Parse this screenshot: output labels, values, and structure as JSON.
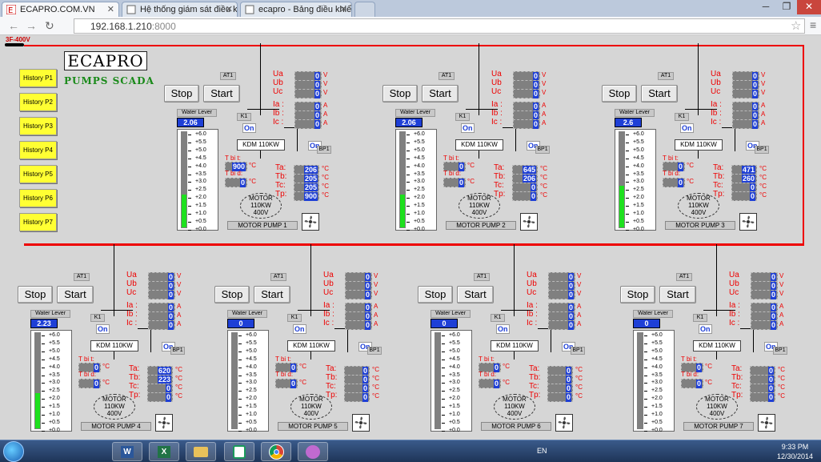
{
  "browser": {
    "tabs": [
      {
        "title": "ECAPRO.COM.VN"
      },
      {
        "title": "Hệ thống giám sát điều kh"
      },
      {
        "title": "ecapro - Bảng điều khiển"
      }
    ],
    "url_host": "192.168.1.210",
    "url_port": ":8000"
  },
  "scada": {
    "panel_tag": "3F-400V",
    "logo": "ECAPRO",
    "subtitle": "PUMPS SCADA",
    "history": [
      "History P1",
      "History P2",
      "History P3",
      "History P4",
      "History P5",
      "History P6",
      "History P7"
    ],
    "labels": {
      "stop": "Stop",
      "start": "Start",
      "water_level": "Water Lever",
      "at1": "AT1",
      "k1": "K1",
      "on": "On",
      "bp1": "BP1",
      "kdm": "KDM 110KW",
      "motor_l1": "MOTOR",
      "motor_l2": "110KW",
      "motor_l3": "400V",
      "ua": "Ua",
      "ub": "Ub",
      "uc": "Uc",
      "ia": "Ia :",
      "ib": "Ib :",
      "ic": "Ic :",
      "ta": "Ta:",
      "tb": "Tb:",
      "tc": "Tc:",
      "tp": "Tp:",
      "tbit": "T bi t:",
      "tbid": "T bi d:",
      "unit_v": "V",
      "unit_a": "A",
      "unit_c": "°C"
    },
    "ticks": [
      "+6.0",
      "+5.5",
      "+5.0",
      "+4.5",
      "+4.0",
      "+3.5",
      "+3.0",
      "+2.5",
      "+2.0",
      "+1.5",
      "+1.0",
      "+0.5",
      "+0.0"
    ],
    "pumps": [
      {
        "name": "MOTOR PUMP 1",
        "level_text": "2.06",
        "level": 2.06,
        "ua": "0",
        "ub": "0",
        "uc": "0",
        "ia": "0",
        "ib": "0",
        "ic": "0",
        "tbit": "900",
        "tbid": "0",
        "ta": "206",
        "tb": "205",
        "tc": "205",
        "tp": "900"
      },
      {
        "name": "MOTOR PUMP 2",
        "level_text": "2.06",
        "level": 2.06,
        "ua": "0",
        "ub": "0",
        "uc": "0",
        "ia": "0",
        "ib": "0",
        "ic": "0",
        "tbit": "0",
        "tbid": "0",
        "ta": "645",
        "tb": "206",
        "tc": "0",
        "tp": "0"
      },
      {
        "name": "MOTOR PUMP 3",
        "level_text": "2.6",
        "level": 2.6,
        "ua": "0",
        "ub": "0",
        "uc": "0",
        "ia": "0",
        "ib": "0",
        "ic": "0",
        "tbit": "0",
        "tbid": "0",
        "ta": "471",
        "tb": "260",
        "tc": "0",
        "tp": "0"
      },
      {
        "name": "MOTOR PUMP 4",
        "level_text": "2.23",
        "level": 2.23,
        "ua": "0",
        "ub": "0",
        "uc": "0",
        "ia": "0",
        "ib": "0",
        "ic": "0",
        "tbit": "0",
        "tbid": "0",
        "ta": "620",
        "tb": "223",
        "tc": "0",
        "tp": "0"
      },
      {
        "name": "MOTOR PUMP 5",
        "level_text": "0",
        "level": 0,
        "ua": "0",
        "ub": "0",
        "uc": "0",
        "ia": "0",
        "ib": "0",
        "ic": "0",
        "tbit": "0",
        "tbid": "0",
        "ta": "0",
        "tb": "0",
        "tc": "0",
        "tp": "0"
      },
      {
        "name": "MOTOR PUMP 6",
        "level_text": "0",
        "level": 0,
        "ua": "0",
        "ub": "0",
        "uc": "0",
        "ia": "0",
        "ib": "0",
        "ic": "0",
        "tbit": "0",
        "tbid": "0",
        "ta": "0",
        "tb": "0",
        "tc": "0",
        "tp": "0"
      },
      {
        "name": "MOTOR PUMP 7",
        "level_text": "0",
        "level": 0,
        "ua": "0",
        "ub": "0",
        "uc": "0",
        "ia": "0",
        "ib": "0",
        "ic": "0",
        "tbit": "0",
        "tbid": "0",
        "ta": "0",
        "tb": "0",
        "tc": "0",
        "tp": "0"
      }
    ],
    "level_max": 6.0
  },
  "taskbar": {
    "language": "EN",
    "time": "9:33 PM",
    "date": "12/30/2014",
    "apps": [
      "explorer-icon",
      "app-icon",
      "word-icon",
      "excel-icon",
      "files-icon",
      "network-icon",
      "chrome-icon",
      "paint-icon"
    ]
  },
  "colors": {
    "accent_red": "#e00000",
    "value_blue": "#1e3fd6",
    "level_green": "#1ee01e",
    "history_yellow": "#ffff33"
  }
}
